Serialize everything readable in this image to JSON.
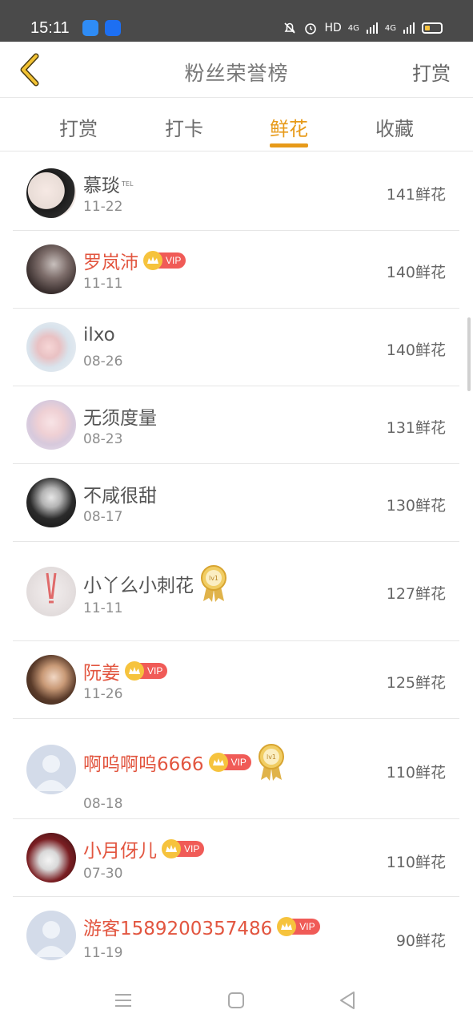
{
  "status_bar": {
    "time": "15:11",
    "right_text": "HD",
    "signal_1": "4G",
    "signal_2": "4G"
  },
  "header": {
    "title": "粉丝荣誉榜",
    "action": "打赏"
  },
  "tabs": [
    {
      "label": "打赏",
      "active": false
    },
    {
      "label": "打卡",
      "active": false
    },
    {
      "label": "鲜花",
      "active": true
    },
    {
      "label": "收藏",
      "active": false
    }
  ],
  "vip_label": "VIP",
  "lv_label": "lv1",
  "tel_label": "TEL",
  "fans": [
    {
      "name": "慕琰",
      "date": "11-22",
      "amount": "141鲜花",
      "vip": false,
      "level": false
    },
    {
      "name": "罗岚沛",
      "date": "11-11",
      "amount": "140鲜花",
      "vip": true,
      "level": false
    },
    {
      "name": "ilxo",
      "date": "08-26",
      "amount": "140鲜花",
      "vip": false,
      "level": false
    },
    {
      "name": "无须度量",
      "date": "08-23",
      "amount": "131鲜花",
      "vip": false,
      "level": false
    },
    {
      "name": "不咸很甜",
      "date": "08-17",
      "amount": "130鲜花",
      "vip": false,
      "level": false
    },
    {
      "name": "小丫么小刺花",
      "date": "11-11",
      "amount": "127鲜花",
      "vip": false,
      "level": true
    },
    {
      "name": "阮姜",
      "date": "11-26",
      "amount": "125鲜花",
      "vip": true,
      "level": false
    },
    {
      "name": "啊呜啊呜6666",
      "date": "08-18",
      "amount": "110鲜花",
      "vip": true,
      "level": true
    },
    {
      "name": "小月伢儿",
      "date": "07-30",
      "amount": "110鲜花",
      "vip": true,
      "level": false
    },
    {
      "name": "游客1589200357486",
      "date": "11-19",
      "amount": "90鲜花",
      "vip": true,
      "level": false
    }
  ],
  "colors": {
    "accent": "#e79a19",
    "vip_name": "#e2553f",
    "vip_badge": "#f05b57"
  }
}
